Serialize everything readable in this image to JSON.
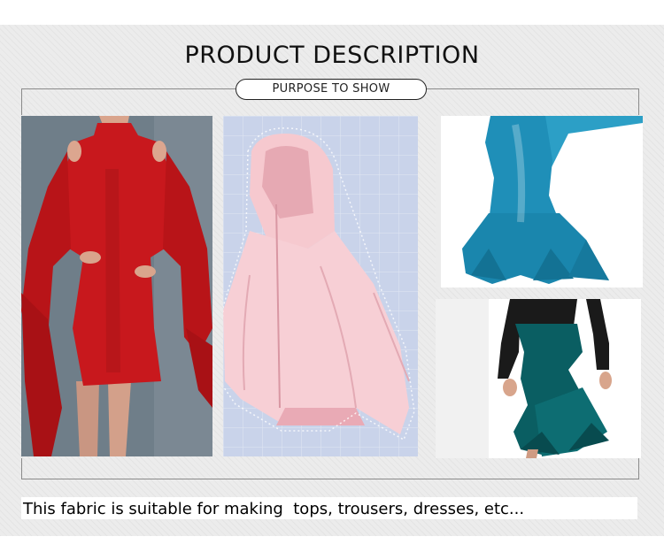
{
  "header": {
    "title": "PRODUCT DESCRIPTION",
    "subtitle": "PURPOSE TO SHOW"
  },
  "photos": [
    {
      "subject": "red long-sleeve dress with cold-shoulder cutouts and ruffle cuffs",
      "accent": "#c8181d"
    },
    {
      "subject": "pink hooded cape jacket on blue grid background",
      "accent": "#f3c3cb"
    },
    {
      "subject": "teal ruffle dress with long sleeves",
      "accent": "#1f8fb8"
    },
    {
      "subject": "dark teal ruffle skirt with black long-sleeve top",
      "accent": "#0a5e62"
    }
  ],
  "footer": {
    "caption": "This fabric is suitable for making  tops, trousers, dresses, etc..."
  }
}
